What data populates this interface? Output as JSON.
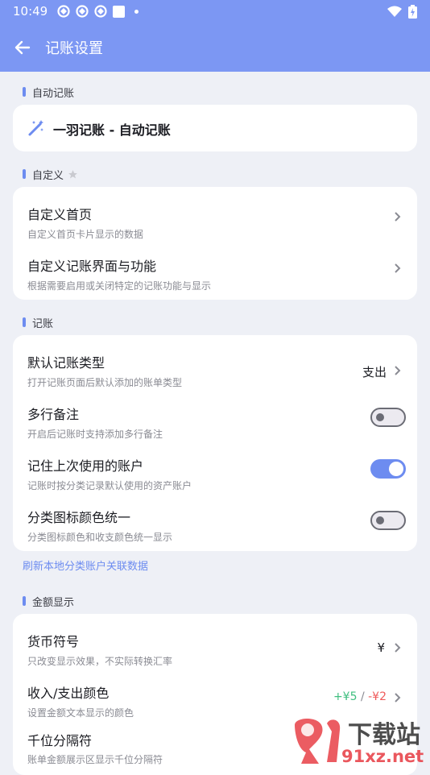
{
  "status_bar": {
    "time": "10:49"
  },
  "header": {
    "title": "记账设置"
  },
  "sections": {
    "auto": {
      "label": "自动记账",
      "item_title": "一羽记账 - 自动记账"
    },
    "custom": {
      "label": "自定义",
      "items": [
        {
          "title": "自定义首页",
          "subtitle": "自定义首页卡片显示的数据"
        },
        {
          "title": "自定义记账界面与功能",
          "subtitle": "根据需要启用或关闭特定的记账功能与显示"
        }
      ]
    },
    "bookkeeping": {
      "label": "记账",
      "items": [
        {
          "title": "默认记账类型",
          "subtitle": "打开记账页面后默认添加的账单类型",
          "value": "支出"
        },
        {
          "title": "多行备注",
          "subtitle": "开启后记账时支持添加多行备注",
          "toggle": false
        },
        {
          "title": "记住上次使用的账户",
          "subtitle": "记账时按分类记录默认使用的资产账户",
          "toggle": true
        },
        {
          "title": "分类图标颜色统一",
          "subtitle": "分类图标颜色和收支颜色统一显示",
          "toggle": false
        }
      ],
      "link": "刷新本地分类账户关联数据"
    },
    "amount": {
      "label": "金额显示",
      "items": [
        {
          "title": "货币符号",
          "subtitle": "只改变显示效果，不实际转换汇率",
          "value": "¥"
        },
        {
          "title": "收入/支出颜色",
          "subtitle": "设置金额文本显示的颜色",
          "income": "+¥5",
          "sep": " / ",
          "expense": "-¥2"
        },
        {
          "title": "千位分隔符",
          "subtitle": "账单金额展示区显示千位分隔符"
        }
      ]
    }
  },
  "colors": {
    "accent": "#7c97f3",
    "toggle_on": "#6d8cf0",
    "income": "#3fbf7f",
    "expense": "#ef5a5a"
  },
  "watermark": {
    "text_main": "下载站",
    "text_domain": "91xz.net"
  }
}
